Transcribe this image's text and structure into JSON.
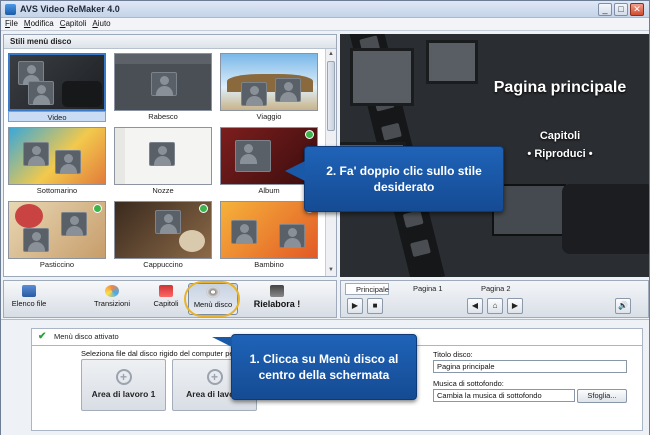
{
  "window": {
    "title": "AVS Video ReMaker 4.0",
    "min": "_",
    "max": "□",
    "close": "✕"
  },
  "menu": [
    "File",
    "Modifica",
    "Capitoli",
    "Aiuto"
  ],
  "styles_panel": {
    "header": "Stili menù disco",
    "tiles": [
      {
        "label": "Video",
        "selected": true
      },
      {
        "label": "Rabesco",
        "selected": false
      },
      {
        "label": "Viaggio",
        "selected": false
      },
      {
        "label": "Sottomarino",
        "selected": false
      },
      {
        "label": "Nozze",
        "selected": false
      },
      {
        "label": "Album",
        "selected": false
      },
      {
        "label": "Pasticcino",
        "selected": false
      },
      {
        "label": "Cappuccino",
        "selected": false
      },
      {
        "label": "Bambino",
        "selected": false
      }
    ]
  },
  "preview": {
    "title": "Pagina principale",
    "chapters": "Capitoli",
    "play": "• Riproduci •"
  },
  "toolbar": {
    "buttons": [
      "Elenco file",
      "Transizioni",
      "Capitoli",
      "Menù disco",
      "Rielabora !"
    ],
    "active": "Menù disco"
  },
  "preview_controls": {
    "tabs": [
      "Principale",
      "Pagina 1",
      "Pagina 2"
    ],
    "play_icon": "▶",
    "stop_icon": "■",
    "prev_icon": "◀",
    "home_icon": "⌂",
    "next_icon": "▶",
    "volume_icon": "🔊"
  },
  "bottom": {
    "status": "Menù disco attivato",
    "select_label": "Seleziona file dal disco rigido del computer per p",
    "area1": "Area di lavoro 1",
    "area2": "Area di lavoro",
    "disc_title_label": "Titolo disco:",
    "disc_title_value": "Pagina principale",
    "music_label": "Musica di sottofondo:",
    "music_value": "Cambia la musica di sottofondo",
    "browse": "Sfoglia..."
  },
  "callouts": {
    "step1": "1. Clicca su Menù disco al centro della schermata",
    "step2": "2. Fa' doppio clic sullo stile desiderato"
  },
  "colors": {
    "callout": "#1a58a8",
    "highlight": "#e7b32a",
    "selection": "#3a78c8"
  }
}
